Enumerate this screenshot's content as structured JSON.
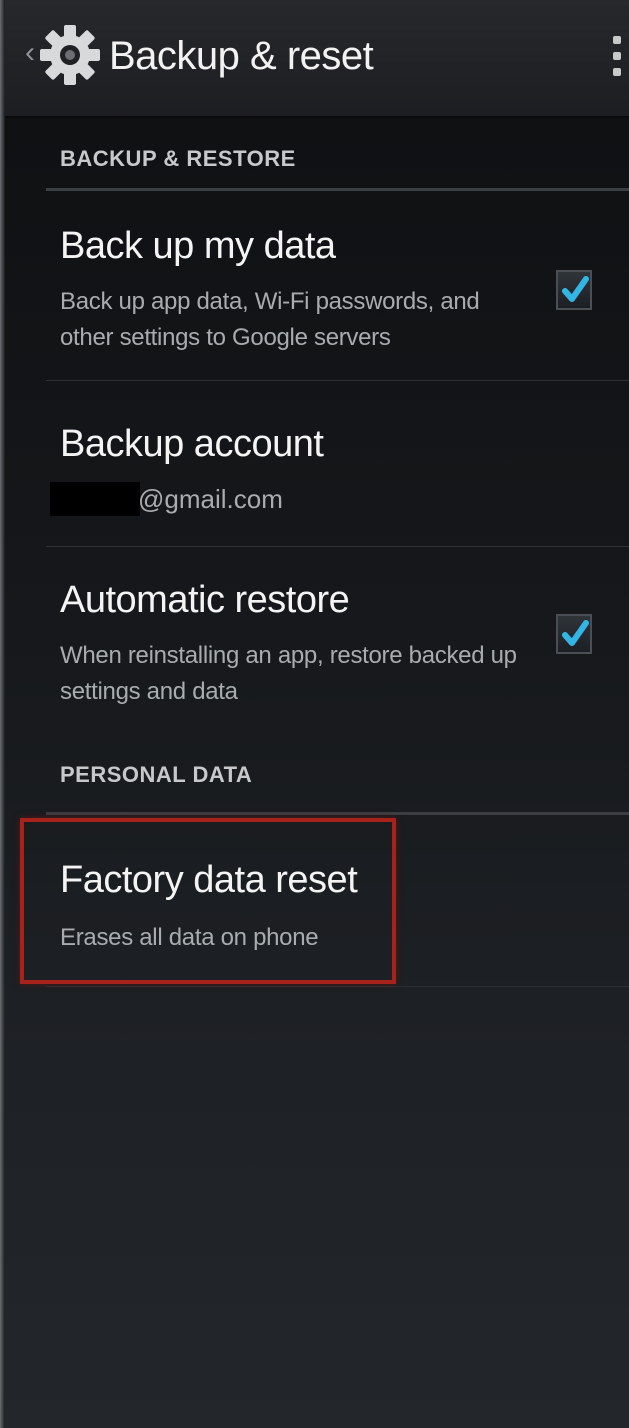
{
  "action_bar": {
    "title": "Backup & reset",
    "up_icon": "chevron-left-icon",
    "app_icon": "gear-icon",
    "menu_icon": "overflow-menu-icon"
  },
  "backup_restore": {
    "header": "BACKUP & RESTORE",
    "items": [
      {
        "title": "Back up my data",
        "summary": "Back up app data, Wi-Fi passwords, and other settings to Google servers",
        "checked": true
      },
      {
        "title": "Backup account",
        "summary_redacted": true,
        "summary_suffix": "@gmail.com"
      },
      {
        "title": "Automatic restore",
        "summary": "When reinstalling an app, restore backed up settings and data",
        "checked": true
      }
    ]
  },
  "personal_data": {
    "header": "PERSONAL DATA",
    "items": [
      {
        "title": "Factory data reset",
        "summary": "Erases all data on phone",
        "highlighted": true
      }
    ]
  },
  "colors": {
    "accent_check": "#33b5e5",
    "highlight_border": "#a7221b",
    "background": "#15171a"
  }
}
